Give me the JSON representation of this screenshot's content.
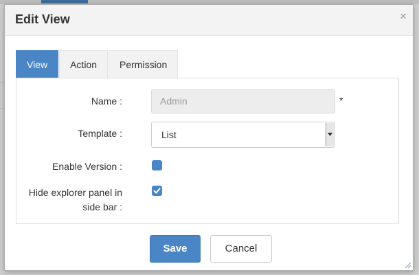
{
  "dialog": {
    "title": "Edit View",
    "close_glyph": "×"
  },
  "tabs": [
    {
      "label": "View",
      "active": true
    },
    {
      "label": "Action",
      "active": false
    },
    {
      "label": "Permission",
      "active": false
    }
  ],
  "form": {
    "name": {
      "label": "Name :",
      "value": "Admin",
      "required_marker": "*",
      "disabled": true
    },
    "template": {
      "label": "Template :",
      "selected": "List"
    },
    "enable_version": {
      "label": "Enable Version :",
      "checked": false
    },
    "hide_explorer": {
      "label_line1": "Hide explorer panel in",
      "label_line2": "side bar :",
      "checked": true
    }
  },
  "buttons": {
    "save": "Save",
    "cancel": "Cancel"
  },
  "colors": {
    "accent": "#4a86c5",
    "header_bg": "#f3f3f3"
  },
  "icons": {
    "close": "close-icon",
    "select_arrow": "chevron-down-icon",
    "check": "check-icon",
    "resize": "resize-grip-icon"
  }
}
